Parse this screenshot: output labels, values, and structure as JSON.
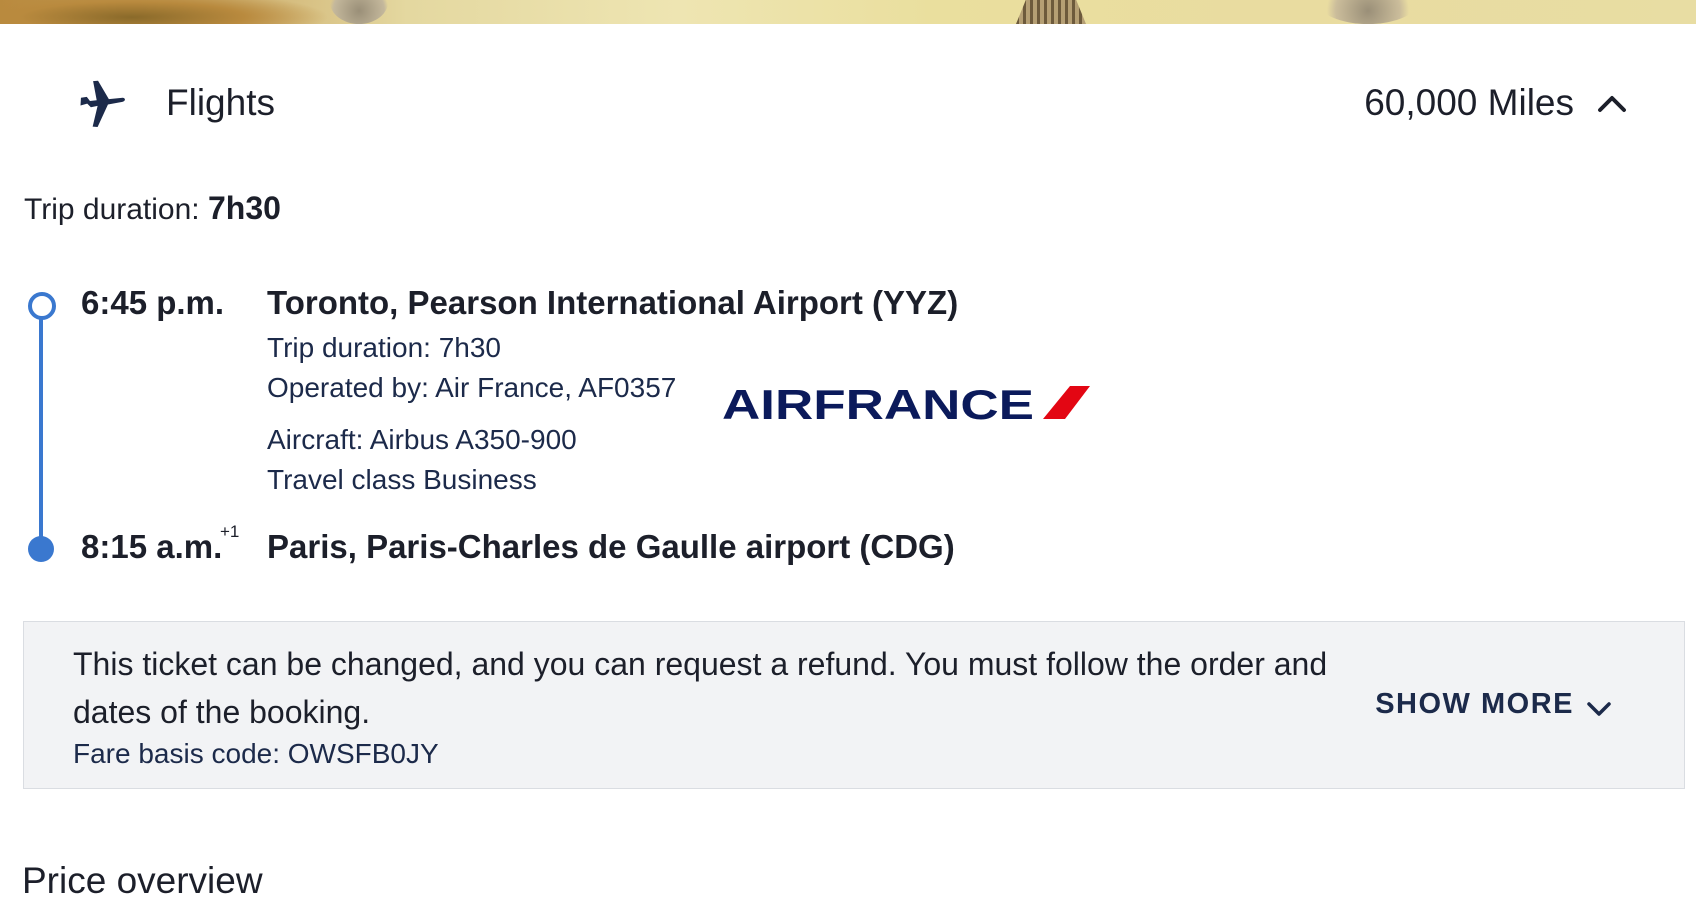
{
  "colors": {
    "accent": "#3a78cf",
    "text": "#1c1f2a",
    "fare_bg": "#f2f3f5",
    "airfrance_navy": "#0b1a5b",
    "airfrance_red": "#e30613"
  },
  "icons": {
    "plane": "plane-icon",
    "collapse": "chevron-up-icon",
    "expand": "chevron-down-icon"
  },
  "flights": {
    "title": "Flights",
    "miles": "60,000 Miles",
    "trip_duration_label": "Trip duration:",
    "trip_duration_value": "7h30"
  },
  "segment": {
    "departure_time": "6:45 p.m.",
    "departure_airport": "Toronto, Pearson International Airport (YYZ)",
    "trip_duration": "Trip duration: 7h30",
    "operated_by": "Operated by: Air France, AF0357",
    "aircraft": "Aircraft: Airbus A350-900",
    "travel_class": "Travel class Business",
    "airline_logo_text": "AIRFRANCE",
    "arrival_time": "8:15 a.m.",
    "arrival_day_offset": "+1",
    "arrival_airport": "Paris, Paris-Charles de Gaulle airport (CDG)"
  },
  "fare": {
    "conditions": "This ticket can be changed, and you can request a refund. You must follow the order and dates of the booking.",
    "basis_code": "Fare basis code: OWSFB0JY",
    "show_more_label": "SHOW MORE"
  },
  "price_overview": {
    "title": "Price overview"
  }
}
